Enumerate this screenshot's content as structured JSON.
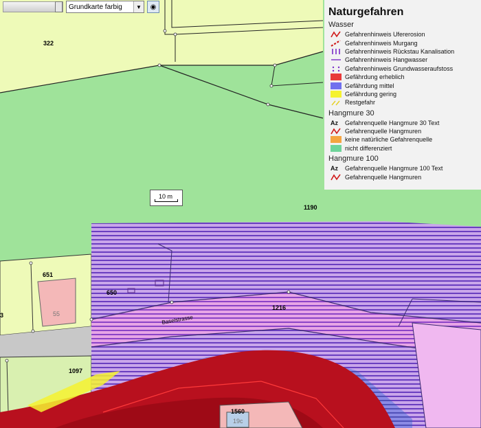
{
  "toolbar": {
    "basemap_select": "Grundkarte farbig"
  },
  "scalebar": {
    "label": "10 m"
  },
  "parcels": [
    "322",
    "1190",
    "651",
    "650",
    "55",
    "1216",
    "Baselstrasse",
    "1097",
    "1560",
    "19c",
    "3"
  ],
  "legend": {
    "title": "Naturgefahren",
    "sections": [
      {
        "name": "Wasser",
        "items": [
          {
            "label": "Gefahrenhinweis Ufererosion",
            "icon": "zigzag-red-icon"
          },
          {
            "label": "Gefahrenhinweis Murgang",
            "icon": "dashed-red-icon"
          },
          {
            "label": "Gefahrenhinweis Rückstau Kanalisation",
            "icon": "bars-purple-icon"
          },
          {
            "label": "Gefahrenhinweis Hangwasser",
            "icon": "line-purple-icon"
          },
          {
            "label": "Gefahrenhinweis Grundwasseraufstoss",
            "icon": "dots-purple-icon"
          },
          {
            "label": "Gefährdung erheblich",
            "icon": "fill-red-icon",
            "color": "#e83a3a"
          },
          {
            "label": "Gefährdung mittel",
            "icon": "fill-blue-icon",
            "color": "#7070ee"
          },
          {
            "label": "Gefährdung gering",
            "icon": "fill-yellow-icon",
            "color": "#f5f230"
          },
          {
            "label": "Restgefahr",
            "icon": "hatch-yellow-icon"
          }
        ]
      },
      {
        "name": "Hangmure 30",
        "items": [
          {
            "label": "Gefahrenquelle Hangmure 30 Text",
            "icon": "az-text-icon"
          },
          {
            "label": "Gefahrenquelle Hangmuren",
            "icon": "zigzag-red-icon"
          },
          {
            "label": "keine natürliche Gefahrenquelle",
            "icon": "fill-orange-icon",
            "color": "#f5a540"
          },
          {
            "label": "nicht differenziert",
            "icon": "fill-green-icon",
            "color": "#6fd49a"
          }
        ]
      },
      {
        "name": "Hangmure 100",
        "items": [
          {
            "label": "Gefahrenquelle Hangmure 100 Text",
            "icon": "az-text-icon"
          },
          {
            "label": "Gefahrenquelle Hangmuren",
            "icon": "zigzag-red-icon"
          }
        ]
      }
    ]
  }
}
